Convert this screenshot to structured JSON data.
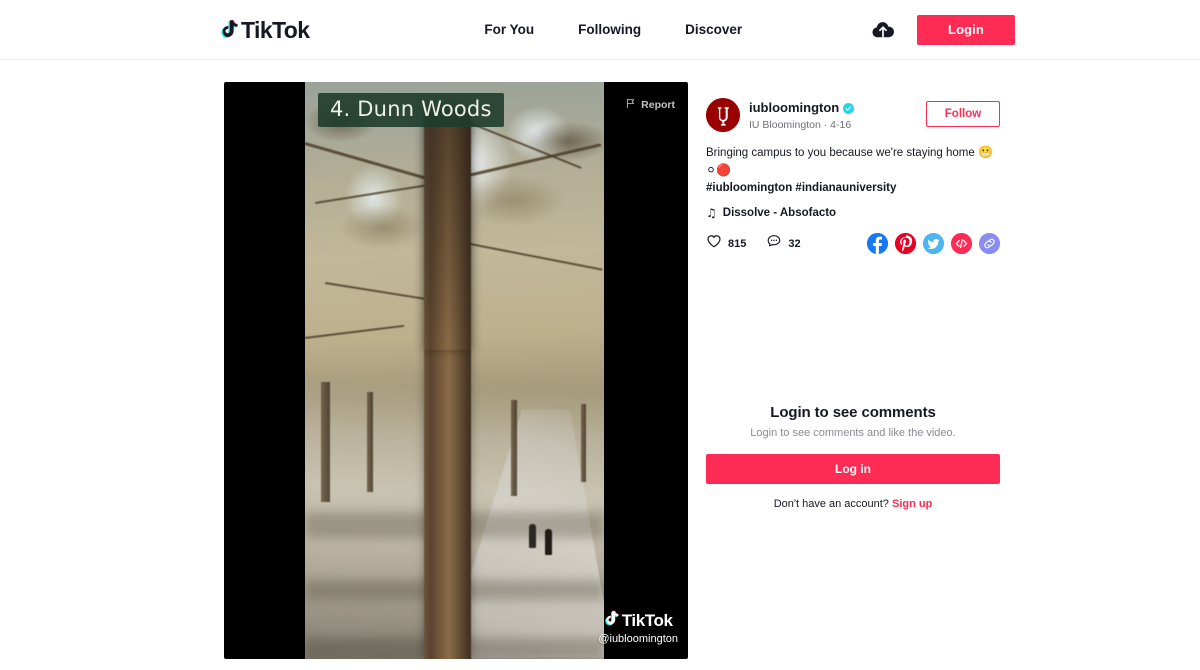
{
  "brand": {
    "name": "TikTok",
    "accent": "#fe2c55",
    "cyan": "#25f4ee",
    "text_dark": "#161823"
  },
  "header": {
    "logo_label": "TikTok",
    "nav": [
      {
        "label": "For You"
      },
      {
        "label": "Following"
      },
      {
        "label": "Discover"
      }
    ],
    "upload_icon": "cloud-upload-icon",
    "login_label": "Login"
  },
  "video": {
    "title_overlay": "4. Dunn Woods",
    "report_label": "Report",
    "report_icon": "flag-icon",
    "watermark_label": "TikTok",
    "watermark_handle": "@iubloomington",
    "scene_description": "forest path with large tree trunk"
  },
  "post": {
    "author": {
      "username": "iubloomington",
      "verified": true,
      "verified_icon": "verified-badge-icon",
      "display_name": "IU Bloomington",
      "date": "4-16",
      "meta_separator": " · ",
      "avatar_label": "IU"
    },
    "follow_label": "Follow",
    "caption_text": "Bringing campus to you because we're staying home ",
    "caption_emojis": "😬⚪🔴",
    "hashtags": "#iubloomington #indianauniversity",
    "music": {
      "icon": "music-note-icon",
      "label": "Dissolve - Absofacto"
    },
    "stats": {
      "like_icon": "heart-icon",
      "like_count": "815",
      "comment_icon": "comment-bubble-icon",
      "comment_count": "32"
    },
    "share": [
      {
        "name": "facebook-share-icon",
        "glyph": "f",
        "color": "#1877f2"
      },
      {
        "name": "pinterest-share-icon",
        "glyph": "P",
        "color": "#e60023"
      },
      {
        "name": "twitter-share-icon",
        "glyph": "t",
        "color": "#4cb5f0"
      },
      {
        "name": "embed-share-icon",
        "glyph": "<|>",
        "color": "#fe2c55"
      },
      {
        "name": "copy-link-icon",
        "glyph": "∞",
        "color": "#8a8df0"
      }
    ]
  },
  "comments_gate": {
    "title": "Login to see comments",
    "subtitle": "Login to see comments and like the video.",
    "button_label": "Log in",
    "footer_prefix": "Don't have an account? ",
    "footer_link": "Sign up"
  }
}
